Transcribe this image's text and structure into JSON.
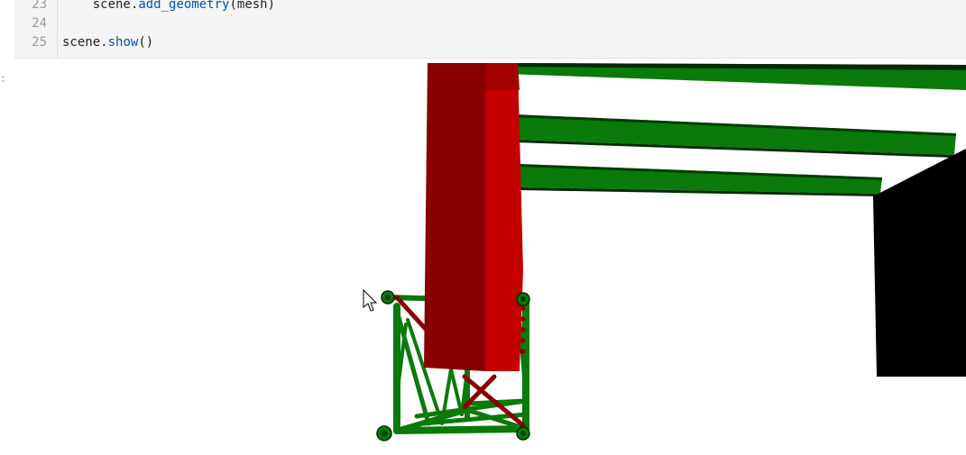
{
  "cell": {
    "lines": [
      {
        "number": "23",
        "indent": "    ",
        "object": "scene",
        "dot": ".",
        "method": "add_geometry",
        "args": "(mesh)"
      },
      {
        "number": "24",
        "indent": "",
        "object": "",
        "dot": "",
        "method": "",
        "args": ""
      },
      {
        "number": "25",
        "indent": "",
        "object": "scene",
        "dot": ".",
        "method": "show",
        "args": "()"
      }
    ]
  },
  "output": {
    "prompt": ":"
  },
  "viewer": {
    "colors": {
      "beam_green": "#0a7a0a",
      "beam_dark": "#063d06",
      "column_red": "#9c0000",
      "column_red_light": "#c40000",
      "block_black": "#000000",
      "background": "#ffffff"
    },
    "cursor_icon": "mouse-pointer-icon"
  }
}
